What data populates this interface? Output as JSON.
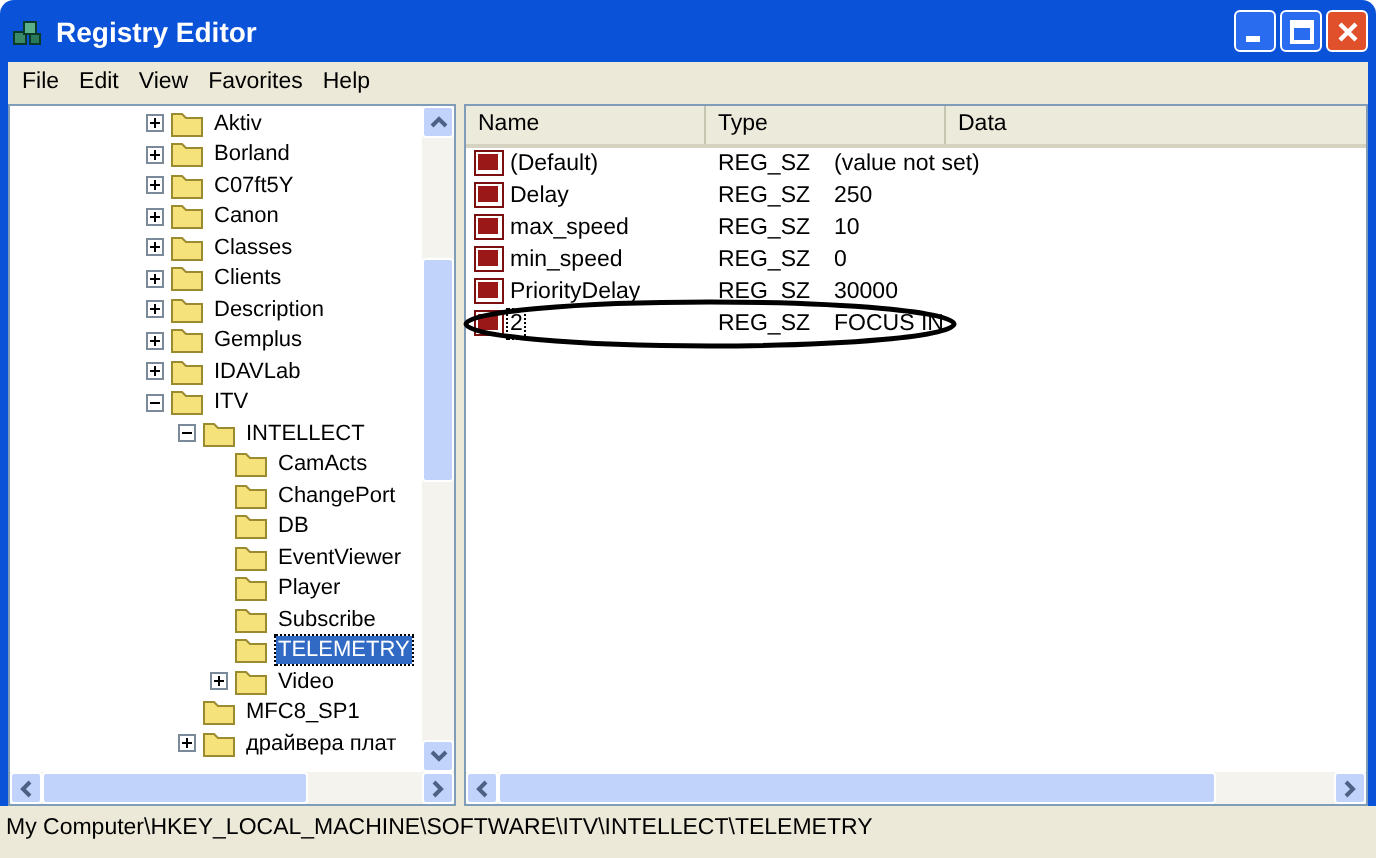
{
  "window": {
    "title": "Registry Editor"
  },
  "menu": [
    "File",
    "Edit",
    "View",
    "Favorites",
    "Help"
  ],
  "tree": [
    {
      "label": "Aktiv",
      "kind": "branch",
      "expanded": false,
      "selected": false
    },
    {
      "label": "Borland",
      "kind": "branch",
      "expanded": false,
      "selected": false
    },
    {
      "label": "C07ft5Y",
      "kind": "branch",
      "expanded": false,
      "selected": false
    },
    {
      "label": "Canon",
      "kind": "branch",
      "expanded": false,
      "selected": false
    },
    {
      "label": "Classes",
      "kind": "branch",
      "expanded": false,
      "selected": false
    },
    {
      "label": "Clients",
      "kind": "branch",
      "expanded": false,
      "selected": false
    },
    {
      "label": "Description",
      "kind": "branch",
      "expanded": false,
      "selected": false
    },
    {
      "label": "Gemplus",
      "kind": "branch",
      "expanded": false,
      "selected": false
    },
    {
      "label": "IDAVLab",
      "kind": "branch",
      "expanded": false,
      "selected": false
    },
    {
      "label": "ITV",
      "kind": "branch",
      "expanded": true,
      "selected": false,
      "children": [
        {
          "label": "INTELLECT",
          "kind": "branch",
          "expanded": true,
          "selected": false,
          "children": [
            {
              "label": "CamActs",
              "kind": "leaf",
              "selected": false
            },
            {
              "label": "ChangePort",
              "kind": "leaf",
              "selected": false
            },
            {
              "label": "DB",
              "kind": "leaf",
              "selected": false
            },
            {
              "label": "EventViewer",
              "kind": "leaf",
              "selected": false
            },
            {
              "label": "Player",
              "kind": "leaf",
              "selected": false
            },
            {
              "label": "Subscribe",
              "kind": "leaf",
              "selected": false
            },
            {
              "label": "TELEMETRY",
              "kind": "leaf",
              "selected": true
            },
            {
              "label": "Video",
              "kind": "branch",
              "expanded": false,
              "selected": false
            }
          ]
        },
        {
          "label": "MFC8_SP1",
          "kind": "leaf",
          "selected": false
        },
        {
          "label": "драйвера плат",
          "kind": "branch",
          "expanded": false,
          "selected": false
        }
      ]
    }
  ],
  "table": {
    "columns": [
      "Name",
      "Type",
      "Data"
    ],
    "rows": [
      {
        "name": "(Default)",
        "type": "REG_SZ",
        "data": "(value not set)",
        "focused": false,
        "circled": false
      },
      {
        "name": "Delay",
        "type": "REG_SZ",
        "data": "250",
        "focused": false,
        "circled": false
      },
      {
        "name": "max_speed",
        "type": "REG_SZ",
        "data": "10",
        "focused": false,
        "circled": false
      },
      {
        "name": "min_speed",
        "type": "REG_SZ",
        "data": "0",
        "focused": false,
        "circled": false
      },
      {
        "name": "PriorityDelay",
        "type": "REG_SZ",
        "data": "30000",
        "focused": false,
        "circled": false
      },
      {
        "name": "2",
        "type": "REG_SZ",
        "data": "FOCUS IN",
        "focused": true,
        "circled": true
      }
    ]
  },
  "status_bar": "My Computer\\HKEY_LOCAL_MACHINE\\SOFTWARE\\ITV\\INTELLECT\\TELEMETRY"
}
